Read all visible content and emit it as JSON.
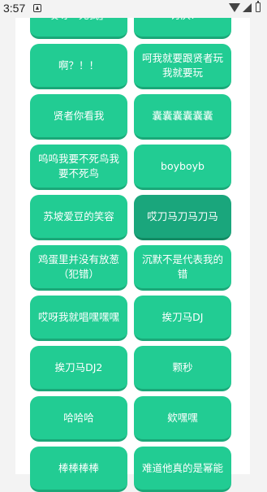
{
  "status_bar": {
    "time": "3:57",
    "icons": [
      "notification-icon",
      "wifi-icon",
      "signal-icon",
      "battery-icon"
    ]
  },
  "colors": {
    "button": "#22cc93",
    "button_selected": "#1aa67c",
    "card": "#ffffff",
    "background": "#f3f3f3"
  },
  "sound_buttons": [
    "哎呀「死我」",
    "讨厌!",
    "啊？！！",
    "呵我就要跟贤者玩我就要玩",
    "贤者你看我",
    "囊囊囊囊囊囊",
    "呜呜我要不死鸟我要不死鸟",
    "boyboyb",
    "苏坡爱豆的笑容",
    "哎刀马刀马刀马",
    "鸡蛋里并没有放葱（犯错）",
    "沉默不是代表我的错",
    "哎呀我就唱嘿嘿嘿",
    "挨刀马DJ",
    "挨刀马DJ2",
    "颗秒",
    "哈哈哈",
    "欸嘿嘿",
    "棒棒棒棒",
    "难道他真的是幂能"
  ],
  "selected_index": 9
}
